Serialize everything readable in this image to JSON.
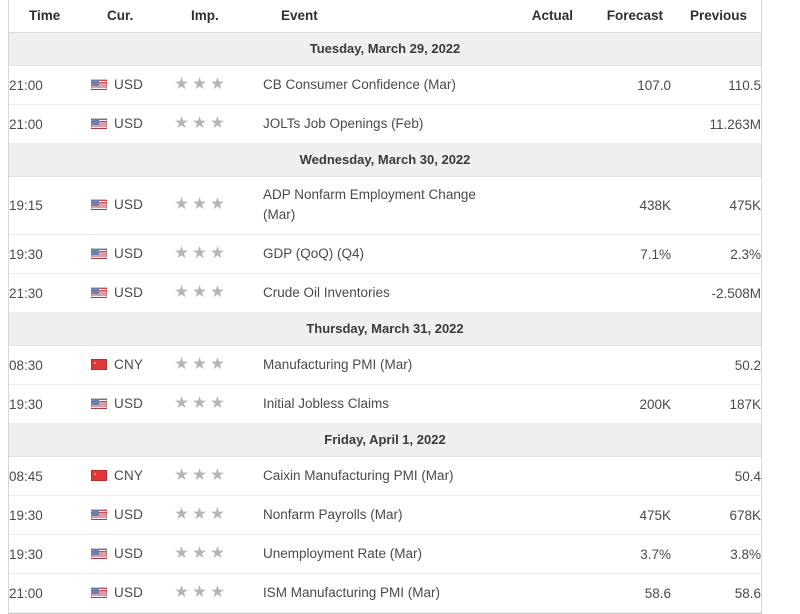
{
  "table": {
    "columns": [
      {
        "key": "time",
        "label": "Time"
      },
      {
        "key": "currency",
        "label": "Cur."
      },
      {
        "key": "importance",
        "label": "Imp."
      },
      {
        "key": "event",
        "label": "Event"
      },
      {
        "key": "actual",
        "label": "Actual"
      },
      {
        "key": "forecast",
        "label": "Forecast"
      },
      {
        "key": "previous",
        "label": "Previous"
      }
    ],
    "colors": {
      "day_header_background": "#efefef",
      "row_background": "#ffffff",
      "border": "#ededed",
      "text": "#4a4a4a",
      "header_text": "#2f2f2f",
      "star": "#b5b5b5",
      "flag_usd_red": "#cf4a52",
      "flag_usd_blue": "#6d7fae",
      "flag_cny_red": "#e0363c"
    },
    "groups": [
      {
        "day_label": "Tuesday, March 29, 2022",
        "rows": [
          {
            "time": "21:00",
            "currency": "USD",
            "flag": "flag-usd",
            "importance": 3,
            "event": "CB Consumer Confidence (Mar)",
            "actual": "",
            "forecast": "107.0",
            "previous": "110.5"
          },
          {
            "time": "21:00",
            "currency": "USD",
            "flag": "flag-usd",
            "importance": 3,
            "event": "JOLTs Job Openings (Feb)",
            "actual": "",
            "forecast": "",
            "previous": "11.263M"
          }
        ]
      },
      {
        "day_label": "Wednesday, March 30, 2022",
        "rows": [
          {
            "time": "19:15",
            "currency": "USD",
            "flag": "flag-usd",
            "importance": 3,
            "event": "ADP Nonfarm Employment Change (Mar)",
            "actual": "",
            "forecast": "438K",
            "previous": "475K",
            "tall": true
          },
          {
            "time": "19:30",
            "currency": "USD",
            "flag": "flag-usd",
            "importance": 3,
            "event": "GDP (QoQ) (Q4)",
            "actual": "",
            "forecast": "7.1%",
            "previous": "2.3%"
          },
          {
            "time": "21:30",
            "currency": "USD",
            "flag": "flag-usd",
            "importance": 3,
            "event": "Crude Oil Inventories",
            "actual": "",
            "forecast": "",
            "previous": "-2.508M"
          }
        ]
      },
      {
        "day_label": "Thursday, March 31, 2022",
        "rows": [
          {
            "time": "08:30",
            "currency": "CNY",
            "flag": "flag-cny",
            "importance": 3,
            "event": "Manufacturing PMI (Mar)",
            "actual": "",
            "forecast": "",
            "previous": "50.2"
          },
          {
            "time": "19:30",
            "currency": "USD",
            "flag": "flag-usd",
            "importance": 3,
            "event": "Initial Jobless Claims",
            "actual": "",
            "forecast": "200K",
            "previous": "187K"
          }
        ]
      },
      {
        "day_label": "Friday, April 1, 2022",
        "rows": [
          {
            "time": "08:45",
            "currency": "CNY",
            "flag": "flag-cny",
            "importance": 3,
            "event": "Caixin Manufacturing PMI (Mar)",
            "actual": "",
            "forecast": "",
            "previous": "50.4"
          },
          {
            "time": "19:30",
            "currency": "USD",
            "flag": "flag-usd",
            "importance": 3,
            "event": "Nonfarm Payrolls (Mar)",
            "actual": "",
            "forecast": "475K",
            "previous": "678K"
          },
          {
            "time": "19:30",
            "currency": "USD",
            "flag": "flag-usd",
            "importance": 3,
            "event": "Unemployment Rate (Mar)",
            "actual": "",
            "forecast": "3.7%",
            "previous": "3.8%"
          },
          {
            "time": "21:00",
            "currency": "USD",
            "flag": "flag-usd",
            "importance": 3,
            "event": "ISM Manufacturing PMI (Mar)",
            "actual": "",
            "forecast": "58.6",
            "previous": "58.6"
          }
        ]
      }
    ]
  }
}
